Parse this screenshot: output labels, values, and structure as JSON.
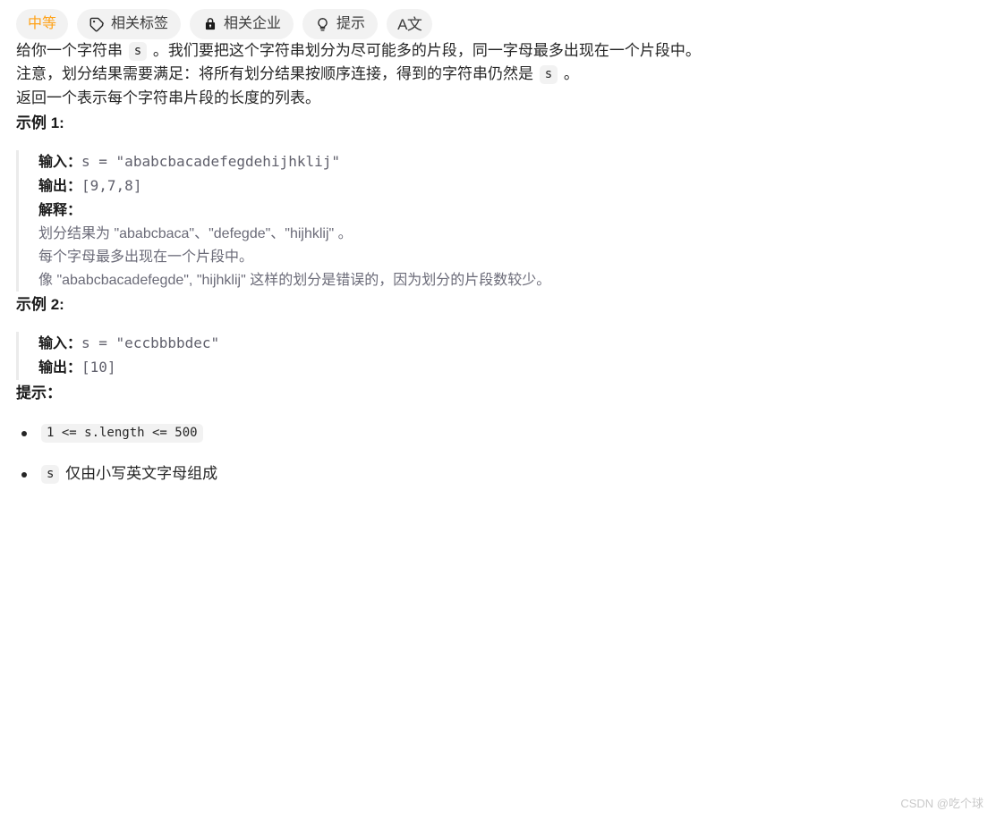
{
  "toolbar": {
    "difficulty": "中等",
    "tags_label": "相关标签",
    "companies_label": "相关企业",
    "hint_label": "提示",
    "translate_label": "A文",
    "accent_color": "#ffa116",
    "chip_bg": "#f2f2f2"
  },
  "description": {
    "p1_before": "给你一个字符串 ",
    "p1_code": "s",
    "p1_after": " 。我们要把这个字符串划分为尽可能多的片段，同一字母最多出现在一个片段中。",
    "p2_before": "注意，划分结果需要满足：将所有划分结果按顺序连接，得到的字符串仍然是 ",
    "p2_code": "s",
    "p2_after": " 。",
    "p3": "返回一个表示每个字符串片段的长度的列表。"
  },
  "examples": [
    {
      "title": "示例 1:",
      "input_label": "输入：",
      "input_value": "s = \"ababcbacadefegdehijhklij\"",
      "output_label": "输出：",
      "output_value": "[9,7,8]",
      "explanation_label": "解释：",
      "explanation_lines": [
        "划分结果为 \"ababcbaca\"、\"defegde\"、\"hijhklij\" 。",
        "每个字母最多出现在一个片段中。",
        "像 \"ababcbacadefegde\", \"hijhklij\" 这样的划分是错误的，因为划分的片段数较少。"
      ]
    },
    {
      "title": "示例 2:",
      "input_label": "输入：",
      "input_value": "s = \"eccbbbbdec\"",
      "output_label": "输出：",
      "output_value": "[10]",
      "explanation_label": "",
      "explanation_lines": []
    }
  ],
  "hints": {
    "title": "提示：",
    "items": [
      {
        "code": "1 <= s.length <= 500",
        "text": ""
      },
      {
        "code": "s",
        "text": " 仅由小写英文字母组成"
      }
    ]
  },
  "watermark": "CSDN @吃个球"
}
